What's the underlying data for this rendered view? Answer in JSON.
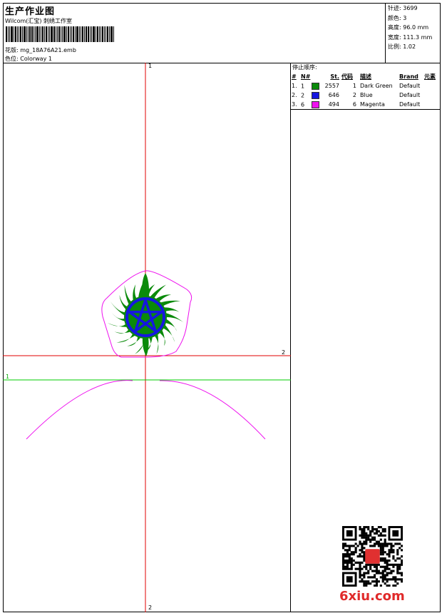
{
  "header": {
    "title": "生产作业图",
    "studio": "Wilcom(汇宝) 刺绣工作室",
    "design_label": "花版: mg_18A76A21.emb",
    "colorway_label": "色位: Colorway 1"
  },
  "stats": {
    "stitches": "针迹: 3699",
    "colors": "颜色: 3",
    "height": "高度: 96.0 mm",
    "width": "宽度: 111.3 mm",
    "scale": "比例: 1.02"
  },
  "sequence": {
    "title": "停止顺序:",
    "headers": [
      "#",
      "N#",
      "St.",
      "代码",
      "描述",
      "Brand",
      "元素"
    ],
    "rows": [
      {
        "idx": "1.",
        "n": "1",
        "stitches": "2557",
        "code": "1",
        "desc": "Dark Green",
        "brand": "Default",
        "color": "#0a8a0a"
      },
      {
        "idx": "2.",
        "n": "2",
        "stitches": "646",
        "code": "2",
        "desc": "Blue",
        "brand": "Default",
        "color": "#1616e0"
      },
      {
        "idx": "3.",
        "n": "6",
        "stitches": "494",
        "code": "6",
        "desc": "Magenta",
        "brand": "Default",
        "color": "#ee10ee"
      }
    ]
  },
  "canvas": {
    "axis_top": "1",
    "axis_bottom": "2",
    "axis_right": "2",
    "axis_left_green": "1"
  },
  "watermark": {
    "logo_text": "6xiu.com"
  },
  "colors": {
    "red_axis": "#e00000",
    "green_axis": "#00cc00",
    "magenta": "#ee10ee",
    "dark_green": "#0a8a0a",
    "blue": "#1616e0"
  }
}
